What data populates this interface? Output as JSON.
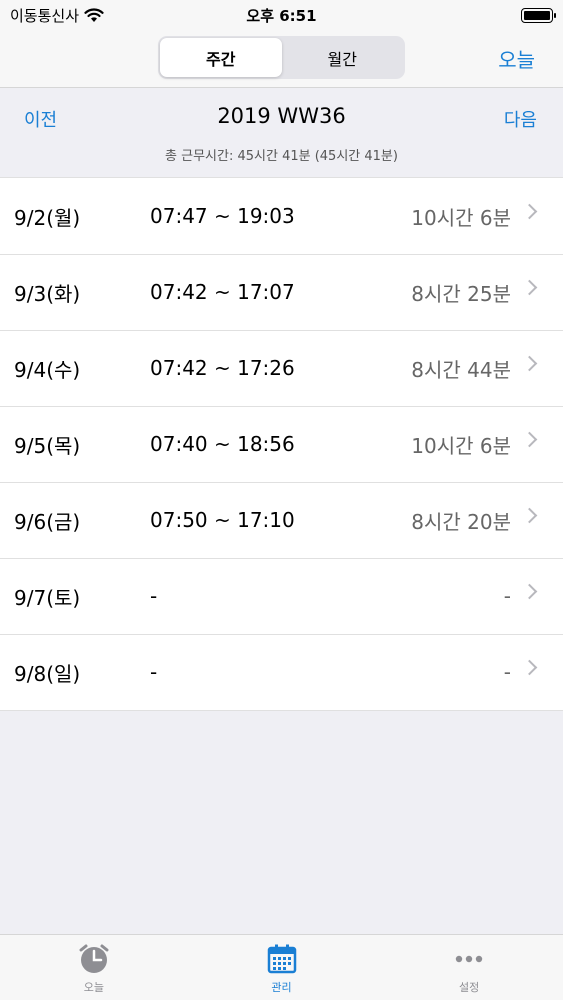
{
  "status": {
    "carrier": "이동통신사",
    "time": "오후 6:51"
  },
  "nav": {
    "segments": [
      {
        "label": "주간"
      },
      {
        "label": "월간"
      }
    ],
    "today_label": "오늘"
  },
  "week": {
    "prev_label": "이전",
    "next_label": "다음",
    "title": "2019 WW36",
    "total": "총 근무시간: 45시간 41분 (45시간 41분)"
  },
  "days": [
    {
      "day": "9/2(월)",
      "time": "07:47 ~ 19:03",
      "duration": "10시간 6분"
    },
    {
      "day": "9/3(화)",
      "time": "07:42 ~ 17:07",
      "duration": "8시간 25분"
    },
    {
      "day": "9/4(수)",
      "time": "07:42 ~ 17:26",
      "duration": "8시간 44분"
    },
    {
      "day": "9/5(목)",
      "time": "07:40 ~ 18:56",
      "duration": "10시간 6분"
    },
    {
      "day": "9/6(금)",
      "time": "07:50 ~ 17:10",
      "duration": "8시간 20분"
    },
    {
      "day": "9/7(토)",
      "time": "-",
      "duration": "-"
    },
    {
      "day": "9/8(일)",
      "time": "-",
      "duration": "-"
    }
  ],
  "tabbar": {
    "tabs": [
      {
        "label": "오늘"
      },
      {
        "label": "관리"
      },
      {
        "label": "설정"
      }
    ]
  },
  "colors": {
    "accent": "#1a7fd4",
    "inactive": "#8e8e93"
  }
}
